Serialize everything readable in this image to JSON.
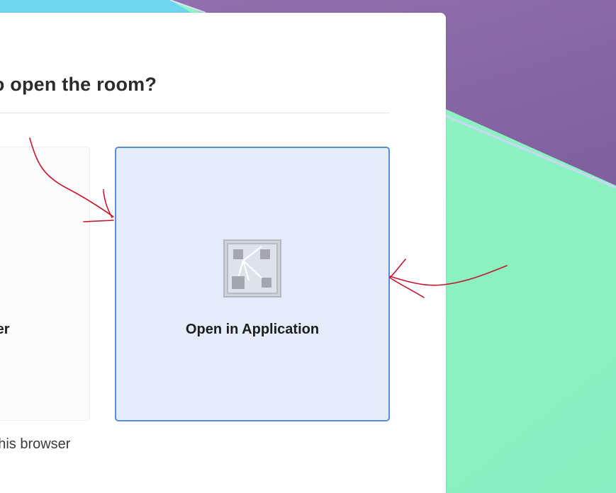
{
  "dialog": {
    "title": "How do you want to open the room?",
    "options": [
      {
        "label": "Open in Browser",
        "selected": false
      },
      {
        "label": "Open in Application",
        "selected": true,
        "icon": "application-grid-icon"
      }
    ],
    "remember_label": "Remember my choice in this browser"
  },
  "colors": {
    "accent_border": "#5a8fd4",
    "selected_fill": "#e3ecf8",
    "annotation_ink": "#c4162a",
    "backdrop_purple": "#8a68a8",
    "backdrop_green": "#8ff5c3"
  },
  "annotations": {
    "description_icons": [
      "hand-drawn-arrow",
      "hand-drawn-arrow"
    ]
  }
}
